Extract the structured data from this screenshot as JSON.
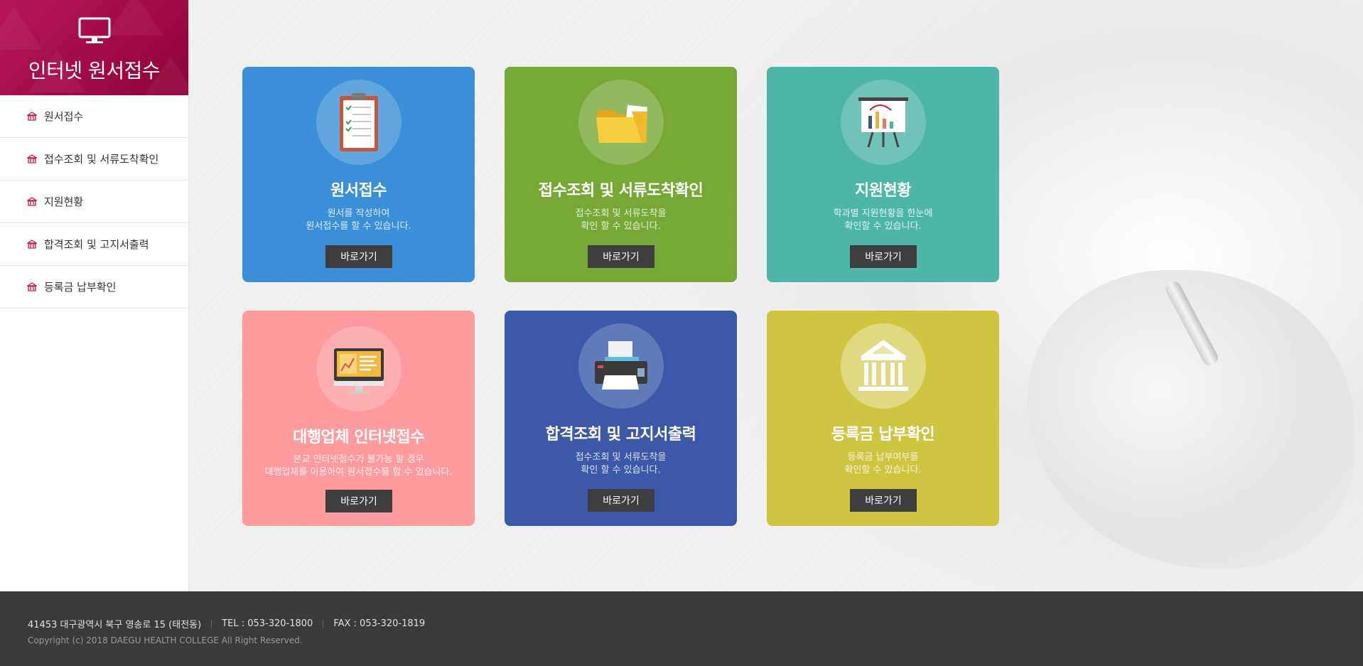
{
  "sidebar": {
    "title": "인터넷 원서접수",
    "items": [
      {
        "label": "원서접수"
      },
      {
        "label": "접수조회 및 서류도착확인"
      },
      {
        "label": "지원현황"
      },
      {
        "label": "합격조회 및 고지서출력"
      },
      {
        "label": "등록금 납부확인"
      }
    ]
  },
  "cards": [
    {
      "title": "원서접수",
      "desc1": "원서를 작성하여",
      "desc2": "원서접수를 할 수 있습니다.",
      "button": "바로가기",
      "color": "#3a8fd8",
      "icon": "clipboard-icon"
    },
    {
      "title": "접수조회 및 서류도착확인",
      "desc1": "접수조회 및 서류도착을",
      "desc2": "확인 할 수 있습니다.",
      "button": "바로가기",
      "color": "#77a836",
      "icon": "folder-icon"
    },
    {
      "title": "지원현황",
      "desc1": "학과별 지원현황을 한눈에",
      "desc2": "확인할 수 있습니다.",
      "button": "바로가기",
      "color": "#4db6a6",
      "icon": "presentation-chart-icon"
    },
    {
      "title": "대행업체 인터넷접수",
      "desc1": "본교 인터넷접수가 불가능 할 경우",
      "desc2": "대행업체를 이용하여 원서접수를 할 수 있습니다.",
      "button": "바로가기",
      "color": "#fe9b9e",
      "icon": "monitor-chart-icon"
    },
    {
      "title": "합격조회 및 고지서출력",
      "desc1": "접수조회 및 서류도착을",
      "desc2": "확인 할 수 있습니다.",
      "button": "바로가기",
      "color": "#3b59a8",
      "icon": "printer-icon"
    },
    {
      "title": "등록금 납부확인",
      "desc1": "등록금 납부여부를",
      "desc2": "확인할 수 있습니다.",
      "button": "바로가기",
      "color": "#cec540",
      "icon": "bank-icon"
    }
  ],
  "footer": {
    "address": "41453 대구광역시 북구 영송로 15 (태전동)",
    "tel": "TEL : 053-320-1800",
    "fax": "FAX : 053-320-1819",
    "copyright": "Copyright (c) 2018 DAEGU HEALTH COLLEGE All Right Reserved."
  },
  "colors": {
    "brand": "#a50d49",
    "footer_bg": "#3a3a3a",
    "button_bg": "#3e3e3e"
  }
}
